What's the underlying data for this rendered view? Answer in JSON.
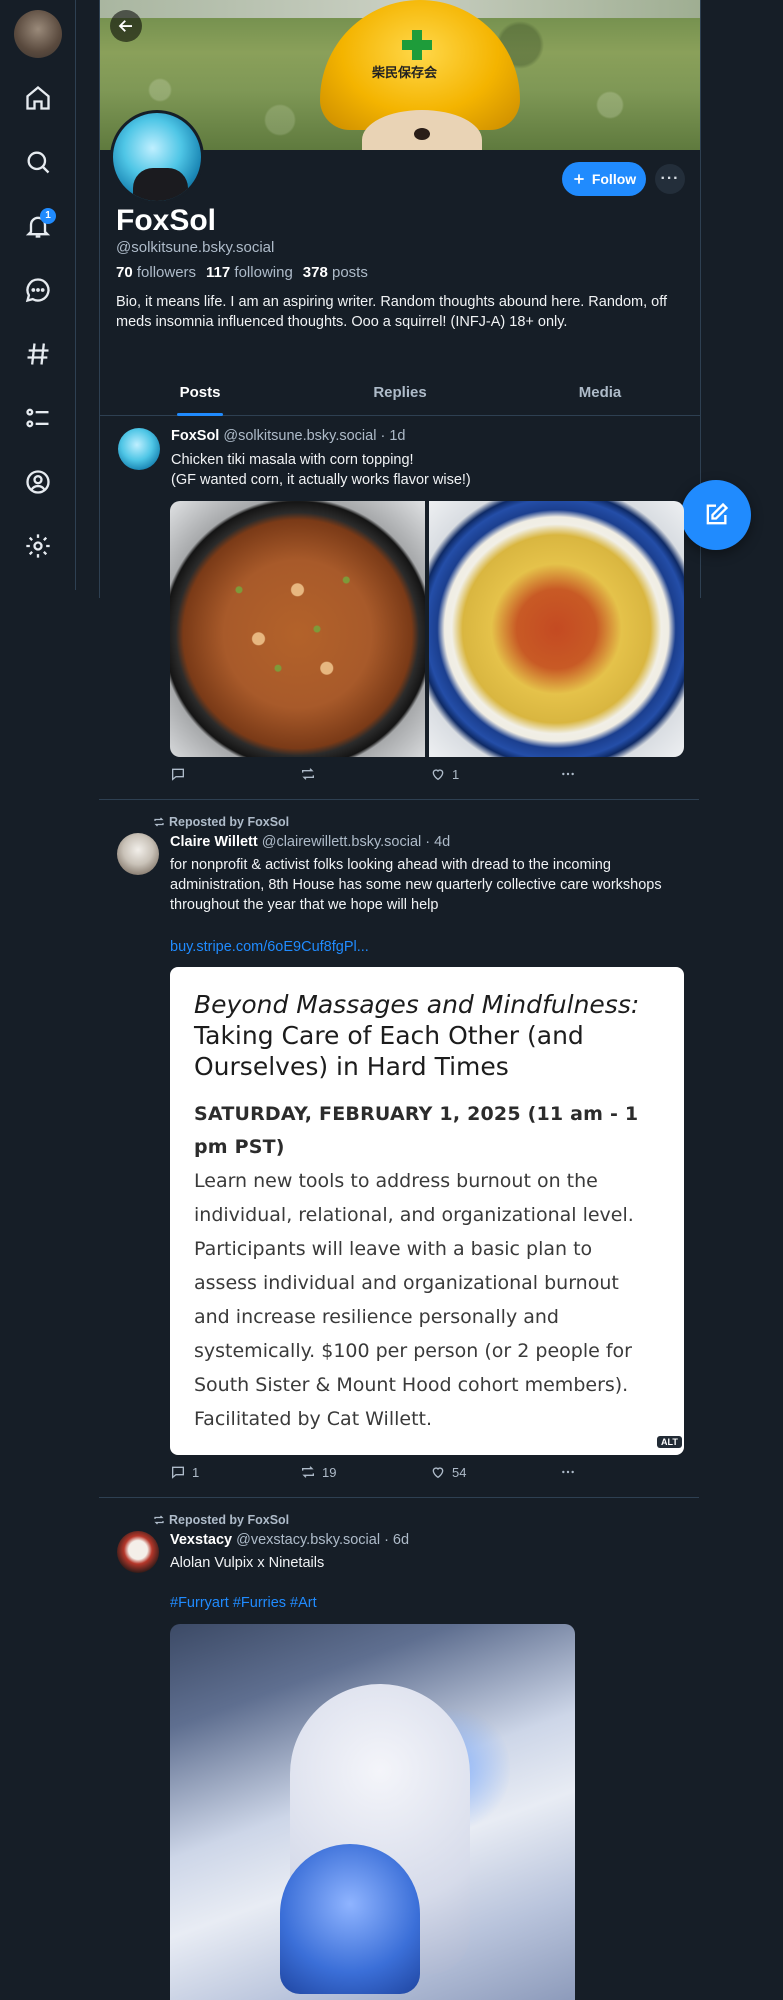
{
  "nav": {
    "notifications_badge": "1",
    "items": [
      "home-icon",
      "search-icon",
      "bell-icon",
      "chat-icon",
      "hashtag-icon",
      "list-icon",
      "profile-icon",
      "settings-icon"
    ]
  },
  "profile": {
    "display_name": "FoxSol",
    "handle": "@solkitsune.bsky.social",
    "followers_count": "70",
    "followers_label": "followers",
    "following_count": "117",
    "following_label": "following",
    "posts_count": "378",
    "posts_label": "posts",
    "bio": "Bio, it means life. I am an aspiring writer. Random thoughts abound here. Random, off meds insomnia influenced thoughts. Ooo a squirrel! (INFJ-A) 18+ only.",
    "follow_label": "Follow",
    "more_label": "···",
    "banner_text": "柴民保存会"
  },
  "tabs": [
    "Posts",
    "Replies",
    "Media"
  ],
  "posts": [
    {
      "author": "FoxSol",
      "meta": "@solkitsune.bsky.social · 1d",
      "text_line1": "Chicken tiki masala with corn topping!",
      "text_line2": "(GF wanted corn, it actually works flavor wise!)",
      "replies": "",
      "reposts": "",
      "likes": "1"
    },
    {
      "repost_label": "Reposted by FoxSol",
      "author": "Claire Willett",
      "meta": "@clairewillett.bsky.social · 4d",
      "text": "for nonprofit & activist folks looking ahead with dread to the incoming administration, 8th House has some new quarterly collective care workshops throughout the year that we hope will help",
      "link": "buy.stripe.com/6oE9Cuf8fgPl...",
      "card_title_italic": "Beyond Massages and Mindfulness:",
      "card_title_rest": "Taking Care of Each Other (and Ourselves) in Hard Times",
      "card_date": "SATURDAY, FEBRUARY 1, 2025 (11 am - 1 pm PST)",
      "card_body": "Learn new tools to address burnout on the individual, relational, and organizational level. Participants will leave with a basic plan to assess individual and organizational burnout and increase resilience personally and systemically. $100 per person (or 2 people for South Sister & Mount Hood cohort members). Facilitated by Cat Willett.",
      "alt_label": "ALT",
      "replies": "1",
      "reposts": "19",
      "likes": "54"
    },
    {
      "repost_label": "Reposted by FoxSol",
      "author": "Vexstacy",
      "meta": "@vexstacy.bsky.social · 6d",
      "text": "Alolan Vulpix x Ninetails",
      "hashtags": "#Furryart #Furries #Art"
    }
  ],
  "colors": {
    "background": "#161e27",
    "accent": "#208bfe",
    "border": "#2e4052",
    "muted_text": "#aebbc9"
  }
}
